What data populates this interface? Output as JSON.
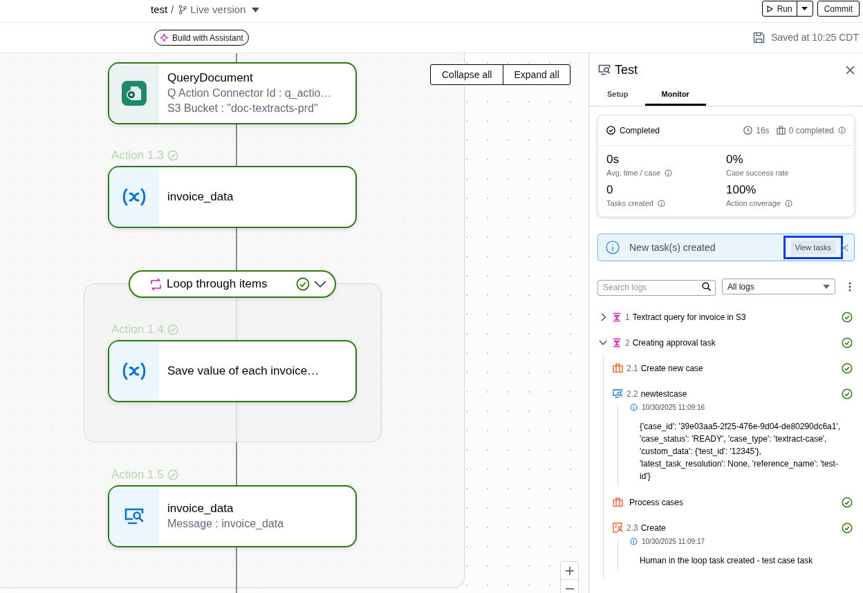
{
  "header": {
    "project": "test",
    "separator": "/",
    "version": "Live version",
    "run_button": "Run",
    "commit_button": "Commit"
  },
  "toolbar": {
    "assistant_button": "Build with Assistant",
    "save_status": "Saved at 10:25 CDT"
  },
  "canvas": {
    "collapse_button": "Collapse all",
    "expand_button": "Expand all",
    "loop": {
      "title": "Loop through items"
    },
    "nodes": [
      {
        "kind": "connector",
        "title": "QueryDocument",
        "lines": [
          "Q Action Connector Id : q_actio…",
          "S3 Bucket : \"doc-textracts-prd\""
        ]
      },
      {
        "kind": "variable",
        "label": "Action 1.3",
        "title": "invoice_data"
      },
      {
        "kind": "variable",
        "label": "Action 1.4",
        "title": "Save value of each invoice…"
      },
      {
        "kind": "message",
        "label": "Action 1.5",
        "title": "invoice_data",
        "lines": [
          "Message : invoice_data"
        ]
      }
    ]
  },
  "panel": {
    "title": "Test",
    "tabs": [
      {
        "label": "Setup",
        "selected": false
      },
      {
        "label": "Monitor",
        "selected": true
      }
    ],
    "summary": {
      "status": "Completed",
      "duration": "16s",
      "completed": "0 completed",
      "stats": [
        {
          "value": "0s",
          "label": "Avg. time / case",
          "info": true
        },
        {
          "value": "0%",
          "label": "Case success rate",
          "info": false
        },
        {
          "value": "0",
          "label": "Tasks created",
          "info": true
        },
        {
          "value": "100%",
          "label": "Action coverage",
          "info": true
        }
      ]
    },
    "alert": {
      "text": "New task(s) created",
      "action": "View tasks",
      "focused": true
    },
    "logs": {
      "search_placeholder": "Search logs",
      "filter": "All logs",
      "items": [
        {
          "number": "1",
          "title": "Textract query for invoice in S3",
          "expanded": false
        },
        {
          "number": "2",
          "title": "Creating approval task",
          "expanded": true,
          "children": [
            {
              "kind": "case",
              "number": "2.1",
              "title": "Create new case"
            },
            {
              "kind": "monitor",
              "number": "2.2",
              "title": "newtestcase",
              "details": [
                {
                  "timestamp": "10/30/2025 11:09:16",
                  "message": "{'case_id': '39e03aa5-2f25-476e-9d04-de80290dc6a1', 'case_status': 'READY', 'case_type': 'textract-case', 'custom_data': {'test_id': '12345'}, 'latest_task_resolution': None, 'reference_name': 'test-id'}"
                }
              ]
            },
            {
              "kind": "case",
              "title": "Process cases"
            },
            {
              "kind": "task",
              "number": "2.3",
              "title": "Create",
              "details": [
                {
                  "timestamp": "10/30/2025 11:09:17",
                  "message": "Human in the loop task created - test case task"
                }
              ]
            }
          ]
        }
      ]
    }
  }
}
